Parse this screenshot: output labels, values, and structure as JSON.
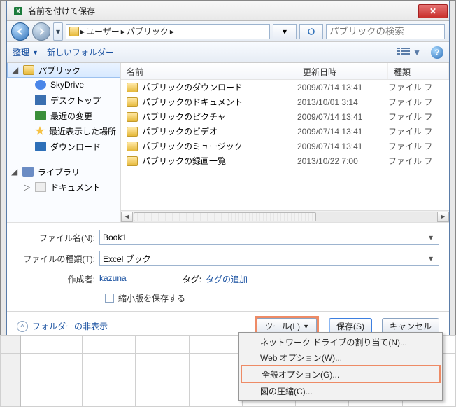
{
  "title": "名前を付けて保存",
  "nav": {
    "path": [
      "ユーザー",
      "パブリック"
    ],
    "refresh_icon": "refresh-icon",
    "search_placeholder": "パブリックの検索"
  },
  "toolbar": {
    "organize": "整理",
    "new_folder": "新しいフォルダー"
  },
  "sidebar": {
    "items": [
      {
        "label": "パブリック",
        "icon": "folder",
        "selected": true,
        "expandable": true
      },
      {
        "label": "SkyDrive",
        "icon": "cloud",
        "indent": true
      },
      {
        "label": "デスクトップ",
        "icon": "desk",
        "indent": true
      },
      {
        "label": "最近の変更",
        "icon": "recent",
        "indent": true
      },
      {
        "label": "最近表示した場所",
        "icon": "star",
        "indent": true
      },
      {
        "label": "ダウンロード",
        "icon": "down",
        "indent": true
      }
    ],
    "section2": [
      {
        "label": "ライブラリ",
        "icon": "lib",
        "expandable": true
      },
      {
        "label": "ドキュメント",
        "icon": "doc",
        "indent": true,
        "expandable": true
      }
    ]
  },
  "columns": {
    "name": "名前",
    "date": "更新日時",
    "type": "種類"
  },
  "rows": [
    {
      "name": "パブリックのダウンロード",
      "date": "2009/07/14 13:41",
      "type": "ファイル フ"
    },
    {
      "name": "パブリックのドキュメント",
      "date": "2013/10/01 3:14",
      "type": "ファイル フ"
    },
    {
      "name": "パブリックのピクチャ",
      "date": "2009/07/14 13:41",
      "type": "ファイル フ"
    },
    {
      "name": "パブリックのビデオ",
      "date": "2009/07/14 13:41",
      "type": "ファイル フ"
    },
    {
      "name": "パブリックのミュージック",
      "date": "2009/07/14 13:41",
      "type": "ファイル フ"
    },
    {
      "name": "パブリックの録画一覧",
      "date": "2013/10/22 7:00",
      "type": "ファイル フ"
    }
  ],
  "form": {
    "filename_label": "ファイル名(N):",
    "filename_value": "Book1",
    "filetype_label": "ファイルの種類(T):",
    "filetype_value": "Excel ブック",
    "author_label": "作成者:",
    "author_value": "kazuna",
    "tags_label": "タグ:",
    "tags_value": "タグの追加",
    "thumb_checkbox": "縮小版を保存する"
  },
  "footer": {
    "hide_folders": "フォルダーの非表示",
    "tools": "ツール(L)",
    "save": "保存(S)",
    "cancel": "キャンセル"
  },
  "menu": {
    "items": [
      "ネットワーク ドライブの割り当て(N)...",
      "Web オプション(W)...",
      "全般オプション(G)...",
      "図の圧縮(C)..."
    ],
    "highlighted": "全般オプション(G)..."
  }
}
